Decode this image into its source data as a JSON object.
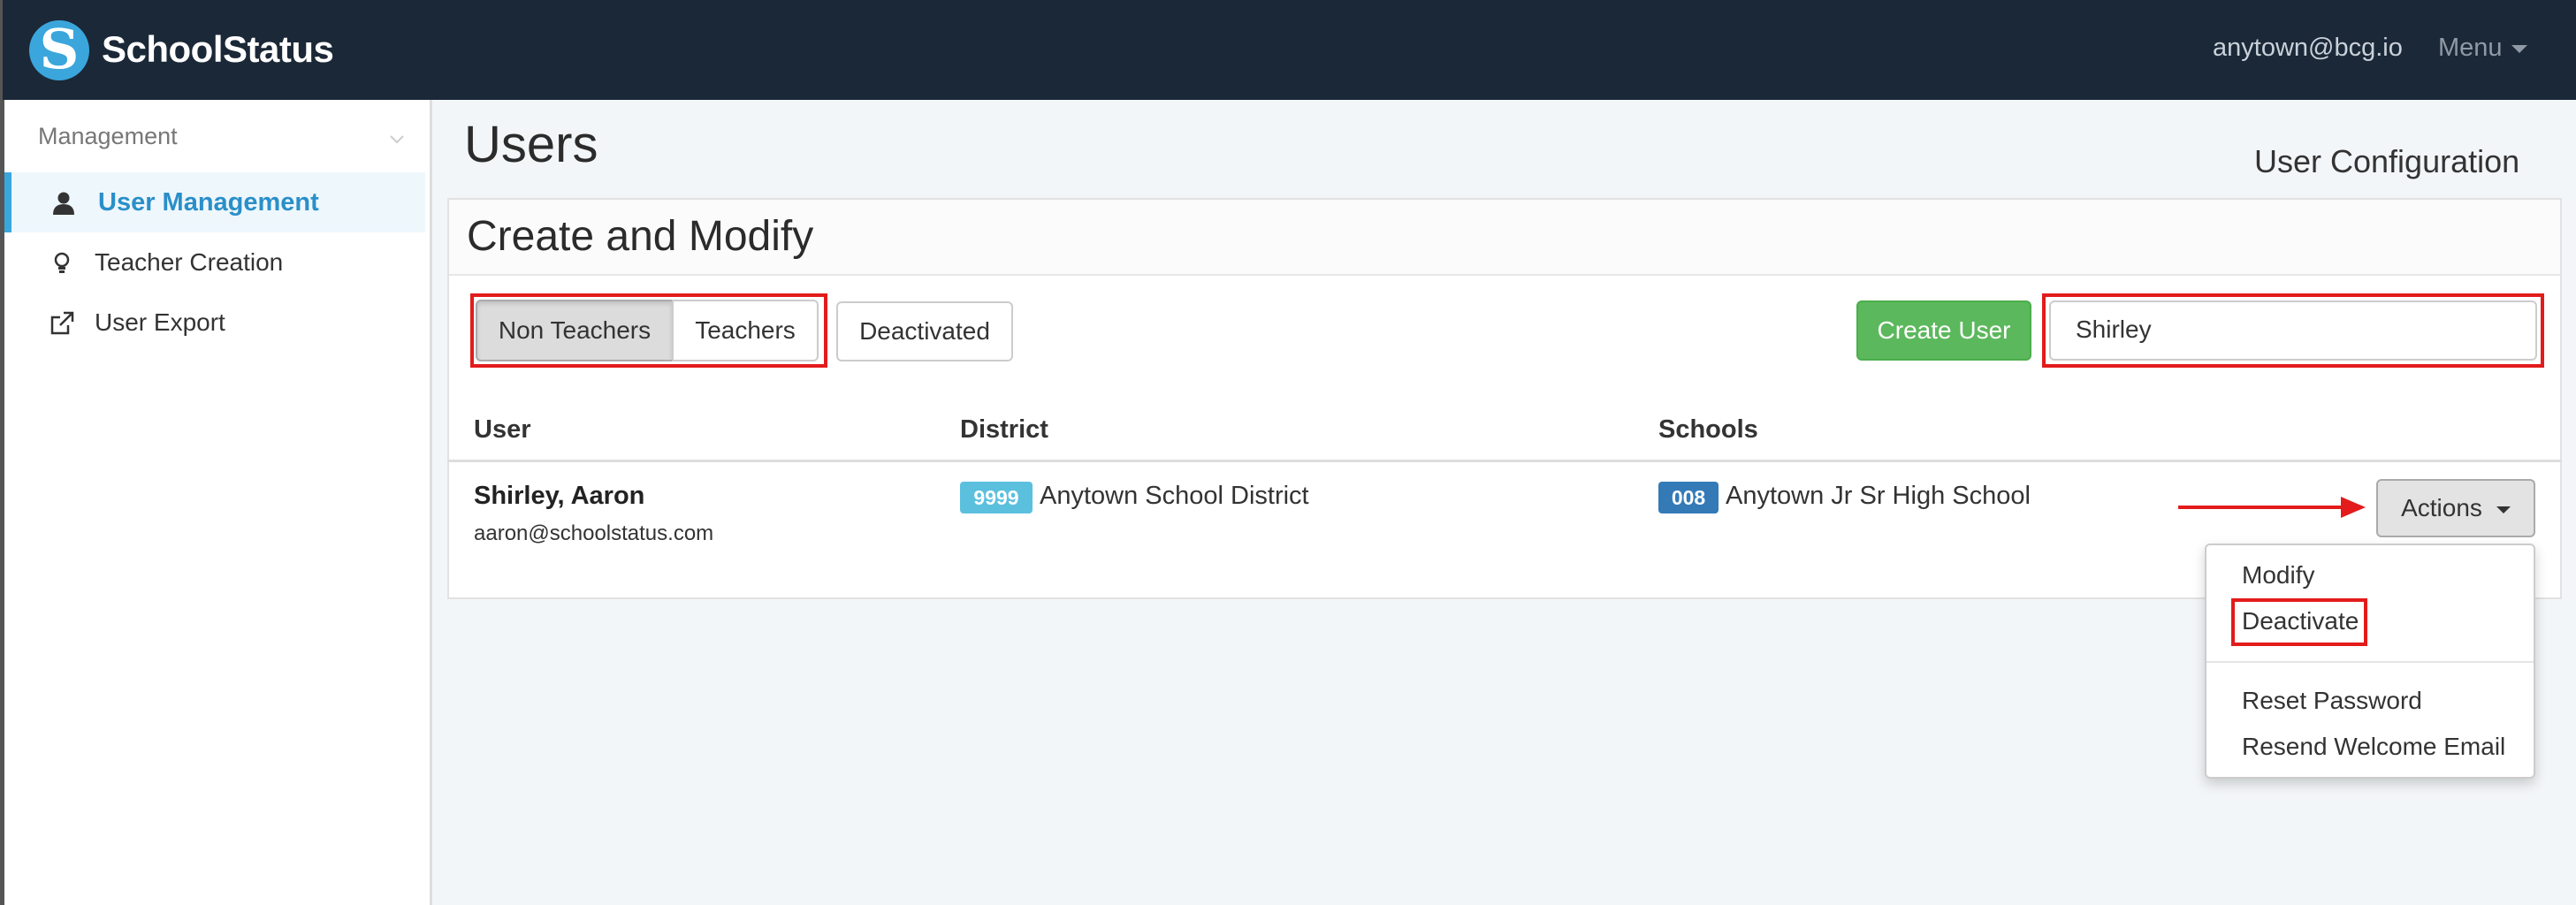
{
  "app": {
    "brand": "SchoolStatus",
    "logo_letter": "S",
    "user_email": "anytown@bcg.io",
    "menu_label": "Menu"
  },
  "sidebar": {
    "section_label": "Management",
    "items": [
      {
        "label": "User Management",
        "icon": "user-icon",
        "active": true
      },
      {
        "label": "Teacher Creation",
        "icon": "lightbulb-icon",
        "active": false
      },
      {
        "label": "User Export",
        "icon": "external-link-icon",
        "active": false
      }
    ]
  },
  "page": {
    "title": "Users",
    "subtitle": "User Configuration"
  },
  "panel": {
    "title": "Create and Modify",
    "filters": {
      "non_teachers": "Non Teachers",
      "teachers": "Teachers",
      "deactivated": "Deactivated"
    },
    "create_user": "Create User",
    "search_value": "Shirley"
  },
  "table": {
    "headers": {
      "user": "User",
      "district": "District",
      "schools": "Schools"
    },
    "rows": [
      {
        "name": "Shirley, Aaron",
        "email": "aaron@schoolstatus.com",
        "district_code": "9999",
        "district_name": "Anytown School District",
        "school_code": "008",
        "school_name": "Anytown Jr Sr High School",
        "actions_label": "Actions"
      }
    ]
  },
  "actions_menu": {
    "items": [
      "Modify",
      "Deactivate",
      "Reset Password",
      "Resend Welcome Email"
    ]
  },
  "colors": {
    "topbar": "#1b2837",
    "accent": "#3aa6dc",
    "green": "#5cb85c",
    "highlight": "#e31b1b",
    "badge_light": "#5bc0de",
    "badge_dark": "#337ab7"
  }
}
